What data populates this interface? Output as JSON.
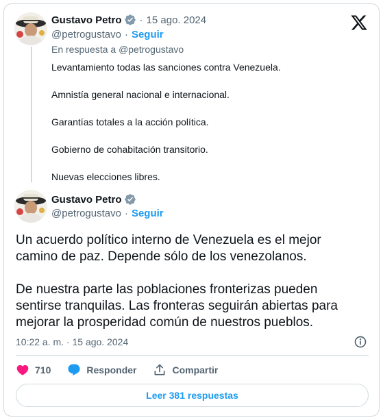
{
  "parent_tweet": {
    "author_name": "Gustavo Petro",
    "handle": "@petrogustavo",
    "date": "15 ago. 2024",
    "follow_label": "Seguir",
    "reply_to_prefix": "En respuesta a",
    "reply_to_handle": "@petrogustavo",
    "paragraphs": [
      "Levantamiento todas las sanciones contra Venezuela.",
      "Amnistía general nacional e internacional.",
      "Garantías totales a la acción política.",
      "Gobierno de cohabitación transitorio.",
      "Nuevas elecciones libres."
    ]
  },
  "main_tweet": {
    "author_name": "Gustavo Petro",
    "handle": "@petrogustavo",
    "follow_label": "Seguir",
    "paragraphs": [
      "Un acuerdo político interno de Venezuela es el mejor camino de paz. Depende sólo de los venezolanos.",
      "De nuestra parte las poblaciones fronterizas pueden sentirse tranquilas. Las fronteras seguirán abiertas para mejorar la prosperidad común de nuestros pueblos."
    ],
    "timestamp": "10:22 a. m. · 15 ago. 2024"
  },
  "actions": {
    "likes": "710",
    "reply_label": "Responder",
    "share_label": "Compartir"
  },
  "read_replies_label": "Leer 381 respuestas",
  "colors": {
    "accent": "#1d9bf0",
    "like": "#f91880",
    "muted": "#536471",
    "border": "#cfd9de"
  },
  "icons": [
    "x-logo-icon",
    "verified-badge-icon",
    "heart-icon",
    "comment-icon",
    "share-icon",
    "info-icon"
  ]
}
